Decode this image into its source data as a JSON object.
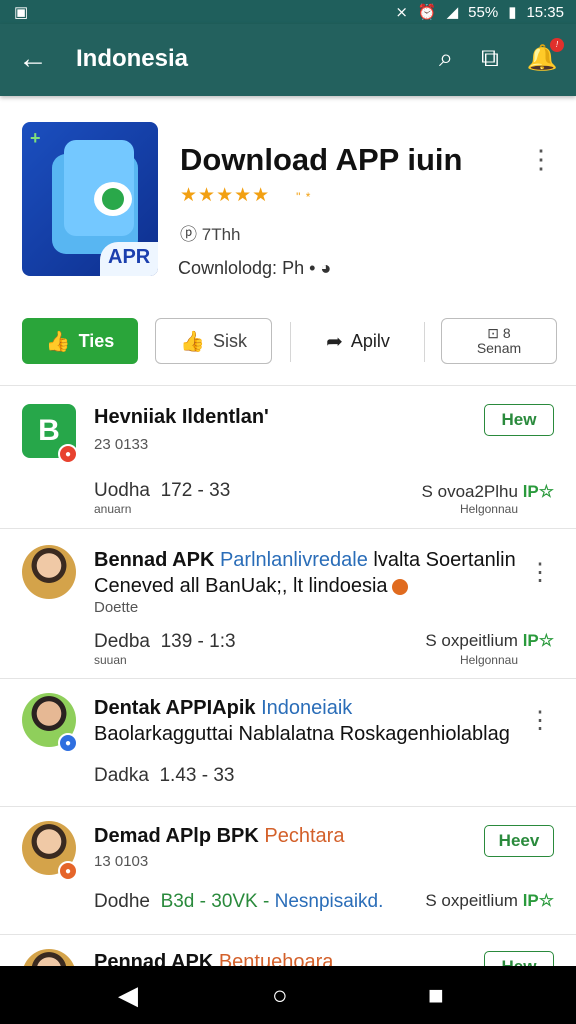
{
  "status": {
    "time": "15:35",
    "battery": "55%"
  },
  "appbar": {
    "title": "Indonesia"
  },
  "app": {
    "title": "Download APP iuin",
    "stars": "★★★★★",
    "stars_tail": "\" *",
    "size": "7Thh",
    "developer": "Cownlolodg: Ph •",
    "icon_label": "APR"
  },
  "actions": {
    "install": "Ties",
    "sok": "Sisk",
    "apply": "Apilv",
    "share_top": "8",
    "share_bottom": "Senam"
  },
  "items": [
    {
      "title": "Hevniiak Ildentlan'",
      "sub": "23 0133",
      "meta_a": "Uodha",
      "meta_b": "172 - 33",
      "meta_sub": "anuarn",
      "right": "S ovoa2Plhu",
      "right_mark": "lP☆",
      "right_sub": "Helgonnau",
      "new_label": "Hew",
      "avatar_letter": "B"
    },
    {
      "title_a": "Bennad APK",
      "title_b": "Parlnlanlivredale",
      "title_c": "lvalta Soertanlin",
      "line2": "Ceneved all BanUak;, lt lindoesia",
      "sub": "Doette",
      "meta_a": "Dedba",
      "meta_b": "139 - 1:3",
      "meta_sub": "suuan",
      "right": "S oxpeitlium",
      "right_mark": "lP☆",
      "right_sub": "Helgonnau"
    },
    {
      "title_a": "Dentak APPIApik",
      "title_b": "Indoneiaik",
      "line2": "Baolarkagguttai Nablalatna Roskagenhiolablag",
      "meta_a": "Dadka",
      "meta_b": "1.43 - 33"
    },
    {
      "title_a": "Demad APlp BPK",
      "title_b": "Pechtara",
      "sub": "13 0103",
      "meta_a": "Dodhe",
      "meta_b": "B3d - 30VK -",
      "meta_c": "Nesnpisaikd.",
      "right": "S oxpeitlium",
      "right_mark": "lP☆",
      "new_label": "Heev"
    },
    {
      "title_a": "Pennad APK",
      "title_b": "Bentuehoara",
      "new_label": "Hew"
    }
  ]
}
